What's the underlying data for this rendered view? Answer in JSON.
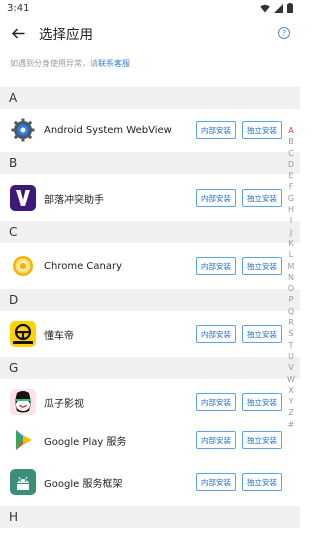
{
  "status": {
    "time": "3:41"
  },
  "appbar": {
    "title": "选择应用",
    "help_glyph": "?"
  },
  "notice": {
    "text": "如遇到分身使用异常，请",
    "link": "联系客服"
  },
  "buttons": {
    "internal": "内部安装",
    "standalone": "独立安装"
  },
  "sections": {
    "A": "A",
    "B": "B",
    "C": "C",
    "D": "D",
    "G": "G",
    "H": "H"
  },
  "apps": [
    {
      "name": "Android System WebView",
      "icon": "webview-gear-icon"
    },
    {
      "name": "部落冲突助手",
      "icon": "clash-helper-v-icon"
    },
    {
      "name": "Chrome Canary",
      "icon": "chrome-canary-icon"
    },
    {
      "name": "懂车帝",
      "icon": "dongchedi-icon"
    },
    {
      "name": "瓜子影视",
      "icon": "guazi-icon"
    },
    {
      "name": "Google Play 服务",
      "icon": "google-play-services-icon"
    },
    {
      "name": "Google 服务框架",
      "icon": "android-framework-icon"
    }
  ],
  "index_letters": [
    "A",
    "B",
    "C",
    "D",
    "E",
    "F",
    "G",
    "H",
    "I",
    "J",
    "K",
    "L",
    "M",
    "N",
    "O",
    "P",
    "Q",
    "R",
    "S",
    "T",
    "U",
    "V",
    "W",
    "X",
    "Y",
    "Z",
    "#"
  ],
  "index_active": "A",
  "colors": {
    "accent": "#2f7fe0",
    "active_index": "#e53935"
  }
}
